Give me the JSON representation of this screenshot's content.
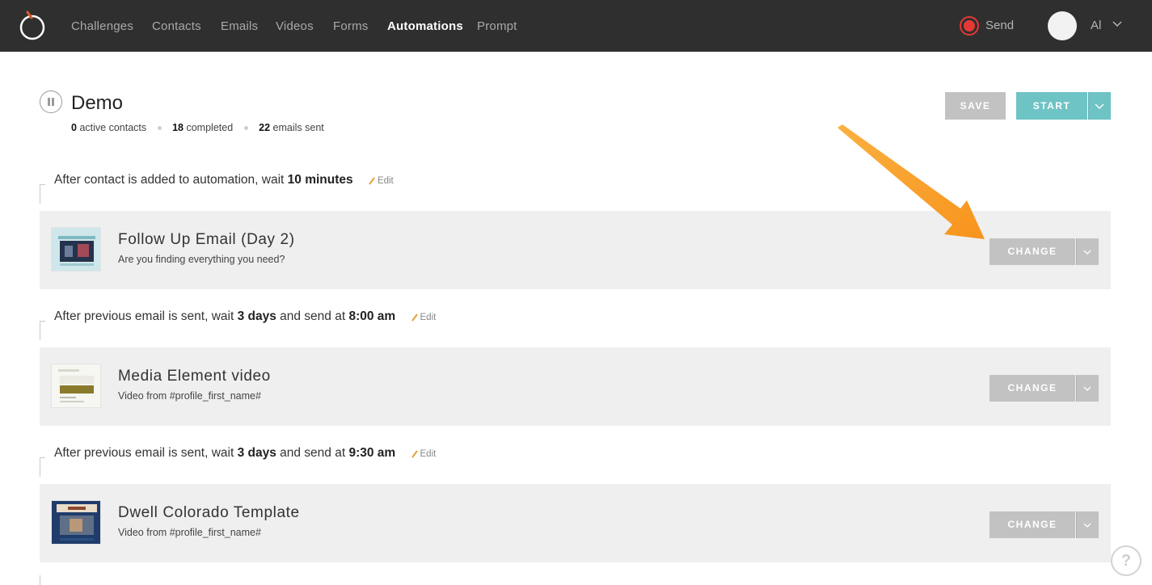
{
  "nav": {
    "items": [
      "Challenges",
      "Contacts",
      "Emails",
      "Videos",
      "Forms",
      "Automations",
      "Prompt"
    ],
    "active": "Automations",
    "send_label": "Send",
    "user_name": "Al"
  },
  "automation": {
    "title": "Demo",
    "active_contacts": "0",
    "active_contacts_label": "active contacts",
    "completed": "18",
    "completed_label": "completed",
    "emails_sent": "22",
    "emails_sent_label": "emails sent",
    "save_label": "SAVE",
    "start_label": "START"
  },
  "waits": [
    {
      "before": "After contact is added to automation, wait ",
      "duration": "10 minutes",
      "mid": "",
      "time": "",
      "edit": "Edit"
    },
    {
      "before": "After previous email is sent, wait ",
      "duration": "3 days",
      "mid": " and send at ",
      "time": "8:00 am",
      "edit": "Edit"
    },
    {
      "before": "After previous email is sent, wait ",
      "duration": "3 days",
      "mid": " and send at ",
      "time": "9:30 am",
      "edit": "Edit"
    }
  ],
  "steps": [
    {
      "title": "Follow Up Email (Day 2)",
      "subtitle": "Are you finding everything you need?",
      "button": "CHANGE"
    },
    {
      "title": "Media Element video",
      "subtitle": "Video from #profile_first_name#",
      "button": "CHANGE"
    },
    {
      "title": "Dwell Colorado Template",
      "subtitle": "Video from #profile_first_name#",
      "button": "CHANGE"
    }
  ],
  "help_label": "?",
  "colors": {
    "accent": "#6ec3c5",
    "record": "#e53935",
    "arrow": "#f7941d",
    "nav_bg": "#2f2f2f"
  }
}
